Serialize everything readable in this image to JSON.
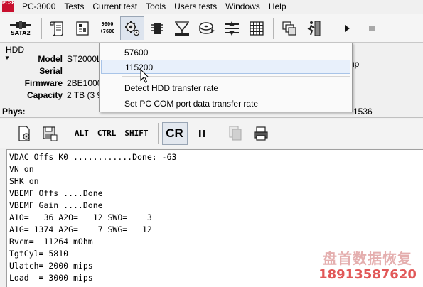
{
  "menubar": {
    "app_icon_text": "PC3K",
    "items": [
      "PC-3000",
      "Tests",
      "Current test",
      "Tools",
      "Users tests",
      "Windows",
      "Help"
    ]
  },
  "toolbar": {
    "sata_label": "SATA2",
    "baud_top": "9600",
    "baud_bottom": "+7600"
  },
  "hdd": {
    "title": "HDD",
    "model_label": "Model",
    "model_value": "ST2000LI",
    "serial_label": "Serial",
    "serial_value": "",
    "firmware_label": "Firmware",
    "firmware_value": "2BE1000",
    "capacity_label": "Capacity",
    "capacity_value": "2 TB (3 9",
    "right_value": "up"
  },
  "phys": {
    "label": "Phys:",
    "value": "1536"
  },
  "term_toolbar": {
    "alt": "ALT",
    "ctrl": "CTRL",
    "shift": "SHIFT",
    "cr": "CR"
  },
  "terminal": {
    "lines": [
      "VDAC Offs K0 ............Done: -63",
      "VN on",
      "SHK on",
      "VBEMF Offs ....Done",
      "VBEMF Gain ....Done",
      "A1O=   36 A2O=   12 SWO=    3",
      "A1G= 1374 A2G=    7 SWG=   12",
      "Rvcm=  11264 mOhm",
      "TgtCyl= 5810",
      "Ulatch= 2000 mips",
      "Load  = 3000 mips"
    ]
  },
  "dropdown": {
    "items": [
      "57600",
      "115200",
      "Detect HDD transfer rate",
      "Set PC COM port data transfer rate"
    ],
    "selected": "115200"
  },
  "watermark": {
    "name": "盘首数据恢复",
    "phone": "18913587620"
  },
  "colors": {
    "accent_red": "#c8102e",
    "selection_bg": "#e8f0fb",
    "watermark_phone": "#e05050"
  }
}
